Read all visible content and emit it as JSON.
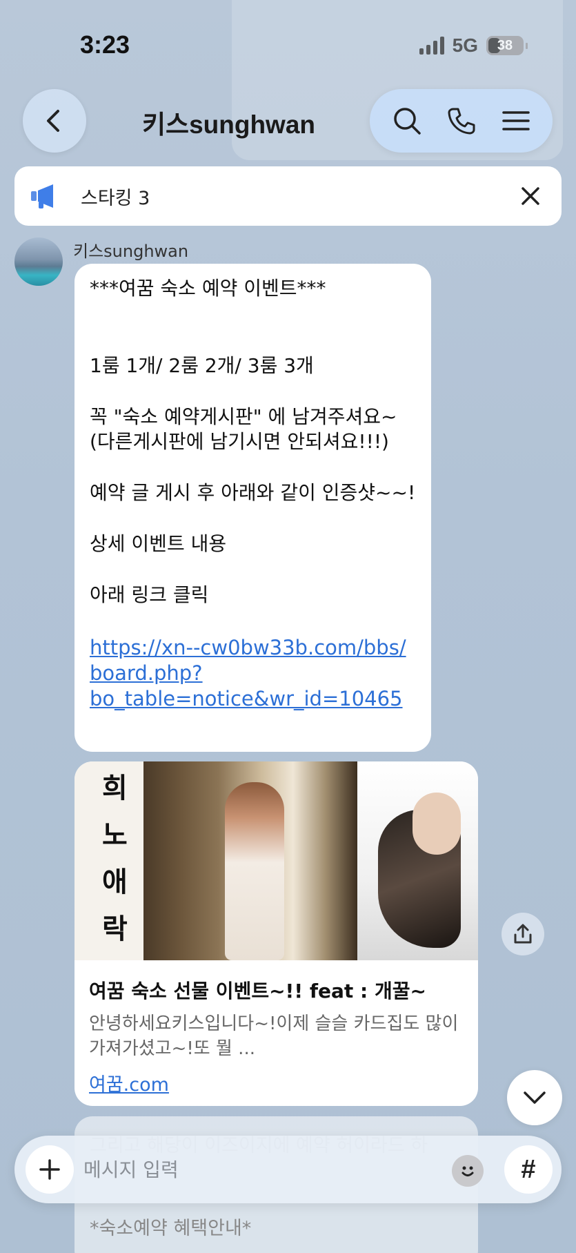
{
  "status_bar": {
    "time": "3:23",
    "network": "5G",
    "battery": "38"
  },
  "header": {
    "title": "키스sunghwan"
  },
  "notice": {
    "text": "스타킹 3"
  },
  "message": {
    "sender": "키스sunghwan",
    "lines": [
      "***여꿈 숙소 예약 이벤트***",
      "",
      "",
      "1룸 1개/ 2룸 2개/ 3룸 3개",
      "",
      "꼭  \"숙소 예약게시판\" 에 남겨주셔요~",
      "(다른게시판에 남기시면 안되셔요!!!)",
      "",
      "예약 글 게시 후 아래와 같이 인증샷~~!",
      "",
      "상세 이벤트 내용",
      "",
      "아래 링크 클릭",
      ""
    ],
    "link_lines": [
      "https://xn--cw0bw33b.com/bbs/",
      "board.php?",
      "bo_table=notice&wr_id=10465"
    ]
  },
  "link_preview": {
    "calligraphy": [
      "희",
      "노",
      "애",
      "락"
    ],
    "title": "여꿈 숙소 선물 이벤트~!! feat : 개꿀~",
    "description": "안녕하세요키스입니다~!이제 슬슬 카드집도 많이 가져가셨고~!또 뭘 ...",
    "domain": "여꿈.com"
  },
  "next_message": {
    "partial_top": "그리고 해당이 이즈이지에 예약 허이라드 하",
    "partial_text": "*숙소예약 혜택안내*"
  },
  "composer": {
    "placeholder": "메시지 입력",
    "hash_label": "#"
  }
}
